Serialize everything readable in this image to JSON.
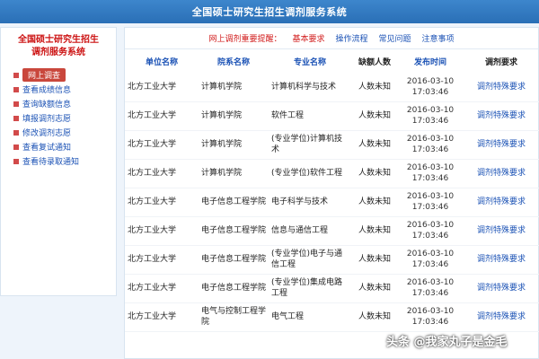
{
  "header": {
    "title": "全国硕士研究生招生调剂服务系统"
  },
  "sidebar": {
    "title_line1": "全国硕士研究生招生",
    "title_line2": "调剂服务系统",
    "items": [
      {
        "label": "网上调查",
        "active": true
      },
      {
        "label": "查看成绩信息"
      },
      {
        "label": "查询缺额信息"
      },
      {
        "label": "填报调剂志愿"
      },
      {
        "label": "修改调剂志愿"
      },
      {
        "label": "查看复试通知"
      },
      {
        "label": "查看待录取通知"
      }
    ]
  },
  "nav": {
    "links": [
      {
        "label": "网上调剂重要提醒：",
        "color": "#d11a1a"
      },
      {
        "label": "基本要求",
        "color": "#d11a1a"
      },
      {
        "label": "操作流程",
        "color": "#1b52b5"
      },
      {
        "label": "常见问题",
        "color": "#1b52b5"
      },
      {
        "label": "注意事项",
        "color": "#1b52b5"
      }
    ]
  },
  "table": {
    "headers": [
      "单位名称",
      "院系名称",
      "专业名称",
      "缺额人数",
      "发布时间",
      "调剂要求"
    ],
    "rows": [
      {
        "unit": "北方工业大学",
        "dept": "计算机学院",
        "major": "计算机科学与技术",
        "vacancy": "人数未知",
        "date": "2016-03-10",
        "time": "17:03:46",
        "action": "调剂特殊要求"
      },
      {
        "unit": "北方工业大学",
        "dept": "计算机学院",
        "major": "软件工程",
        "vacancy": "人数未知",
        "date": "2016-03-10",
        "time": "17:03:46",
        "action": "调剂特殊要求"
      },
      {
        "unit": "北方工业大学",
        "dept": "计算机学院",
        "major": "(专业学位)计算机技术",
        "vacancy": "人数未知",
        "date": "2016-03-10",
        "time": "17:03:46",
        "action": "调剂特殊要求"
      },
      {
        "unit": "北方工业大学",
        "dept": "计算机学院",
        "major": "(专业学位)软件工程",
        "vacancy": "人数未知",
        "date": "2016-03-10",
        "time": "17:03:46",
        "action": "调剂特殊要求"
      },
      {
        "unit": "北方工业大学",
        "dept": "电子信息工程学院",
        "major": "电子科学与技术",
        "vacancy": "人数未知",
        "date": "2016-03-10",
        "time": "17:03:46",
        "action": "调剂特殊要求"
      },
      {
        "unit": "北方工业大学",
        "dept": "电子信息工程学院",
        "major": "信息与通信工程",
        "vacancy": "人数未知",
        "date": "2016-03-10",
        "time": "17:03:46",
        "action": "调剂特殊要求"
      },
      {
        "unit": "北方工业大学",
        "dept": "电子信息工程学院",
        "major": "(专业学位)电子与通信工程",
        "vacancy": "人数未知",
        "date": "2016-03-10",
        "time": "17:03:46",
        "action": "调剂特殊要求"
      },
      {
        "unit": "北方工业大学",
        "dept": "电子信息工程学院",
        "major": "(专业学位)集成电路工程",
        "vacancy": "人数未知",
        "date": "2016-03-10",
        "time": "17:03:46",
        "action": "调剂特殊要求"
      },
      {
        "unit": "北方工业大学",
        "dept": "电气与控制工程学院",
        "major": "电气工程",
        "vacancy": "人数未知",
        "date": "2016-03-10",
        "time": "17:03:46",
        "action": "调剂特殊要求"
      }
    ]
  },
  "watermark": {
    "text": "头条 @我家丸子是金毛"
  }
}
